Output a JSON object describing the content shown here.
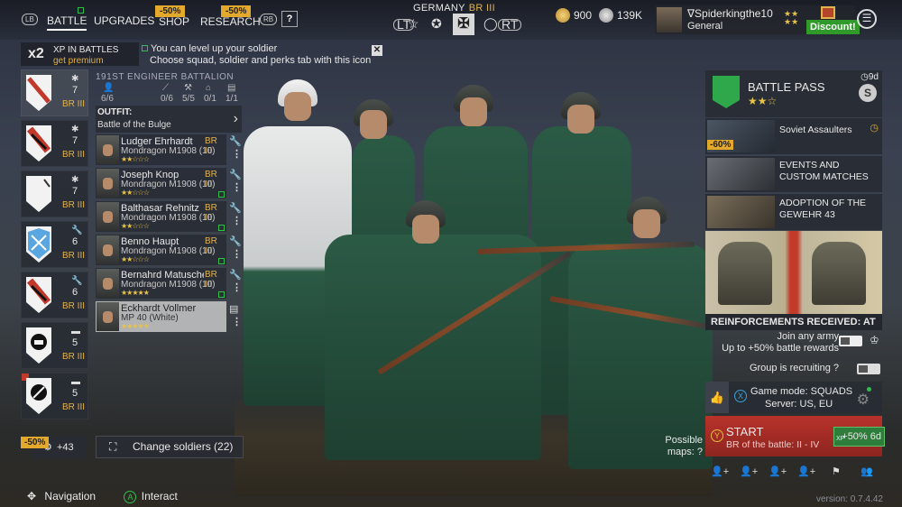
{
  "nav": {
    "lb": "LB",
    "rb": "RB",
    "tabs": [
      {
        "label": "BATTLE",
        "active": true
      },
      {
        "label": "UPGRADES"
      },
      {
        "label": "SHOP",
        "sale": "-50%"
      },
      {
        "label": "RESEARCH",
        "sale": "-50%"
      }
    ],
    "help": "?"
  },
  "army": {
    "name": "GERMANY",
    "br": "BR III",
    "lt": "LT",
    "rt": "RT"
  },
  "currency": {
    "gold": "900",
    "silver": "139K"
  },
  "profile": {
    "name": "∇Spiderkingthe10",
    "rank": "General",
    "discount": "Discount!"
  },
  "xp_banner": {
    "multiplier": "x2",
    "line1": "XP IN BATTLES",
    "line2": "get premium"
  },
  "hint": {
    "line1": "You can level up your soldier",
    "line2": "Choose squad, soldier and perks tab with this icon",
    "close": "✕"
  },
  "squads": [
    {
      "count": "7",
      "br": "BR III"
    },
    {
      "count": "7",
      "br": "BR III"
    },
    {
      "count": "7",
      "br": "BR III"
    },
    {
      "count": "6",
      "br": "BR III"
    },
    {
      "count": "6",
      "br": "BR III"
    },
    {
      "count": "5",
      "br": "BR III"
    },
    {
      "count": "5",
      "br": "BR III"
    }
  ],
  "squad_detail": {
    "title": "191ST ENGINEER BATTALION",
    "stats": [
      "6/6",
      "0/6",
      "5/5",
      "0/1",
      "1/1"
    ]
  },
  "outfit": {
    "label": "OUTFIT:",
    "value": "Battle of the Bulge"
  },
  "soldiers": [
    {
      "name": "Ludger Ehrhardt",
      "weapon": "Mondragon M1908 (10)",
      "br": "BR III",
      "stars": "★★☆☆☆"
    },
    {
      "name": "Joseph Knop",
      "weapon": "Mondragon M1908 (10)",
      "br": "BR III",
      "stars": "★★☆☆☆"
    },
    {
      "name": "Balthasar Rehnitz",
      "weapon": "Mondragon M1908 (10)",
      "br": "BR III",
      "stars": "★★☆☆☆"
    },
    {
      "name": "Benno Haupt",
      "weapon": "Mondragon M1908 (10)",
      "br": "BR III",
      "stars": "★★☆☆☆"
    },
    {
      "name": "Bernahrd Matusche",
      "weapon": "Mondragon M1908 (10)",
      "br": "BR III",
      "stars": "★★★★★"
    },
    {
      "name": "Eckhardt Vollmer",
      "weapon": "MP 40 (White)",
      "br": "",
      "stars": "★★★★★"
    }
  ],
  "bottom_left": {
    "sale": "-50%",
    "count": "+43",
    "change_label": "Change soldiers (22)"
  },
  "hints": {
    "navigation": "Navigation",
    "interact": "Interact",
    "a": "A"
  },
  "battle_pass": {
    "title": "BATTLE PASS",
    "stars": "★★☆",
    "days": "9d",
    "badge": "S"
  },
  "events": [
    {
      "label": "Soviet Assaulters",
      "sale": "-60%"
    },
    {
      "label": "EVENTS AND CUSTOM MATCHES"
    },
    {
      "label": "ADOPTION OF THE GEWEHR 43"
    }
  ],
  "reinforcements": "REINFORCEMENTS RECEIVED: AT",
  "join": {
    "line1": "Join any army",
    "line2": "Up to +50% battle rewards"
  },
  "recruit": "Group is recruiting",
  "mode": {
    "line1": "Game mode: SQUADS",
    "line2": "Server: US, EU",
    "x": "X"
  },
  "start": {
    "label": "START",
    "sub": "BR of the battle: II - IV",
    "y": "Y",
    "xp_boost": "+50% 6d",
    "xp": "XP"
  },
  "maps": {
    "line1": "Possible",
    "line2": "maps:"
  },
  "version": "version: 0.7.4.42"
}
